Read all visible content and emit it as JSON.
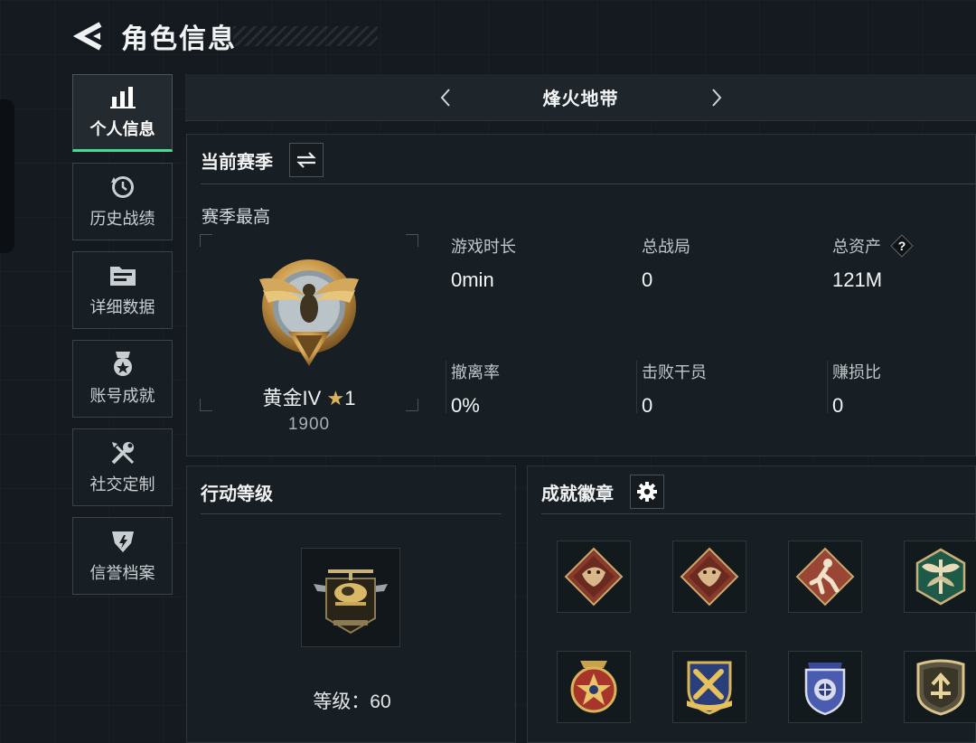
{
  "header": {
    "title": "角色信息"
  },
  "sidebar": {
    "items": [
      {
        "label": "个人信息",
        "icon": "bar-chart-icon",
        "active": true
      },
      {
        "label": "历史战绩",
        "icon": "history-clock-icon",
        "active": false
      },
      {
        "label": "详细数据",
        "icon": "folder-icon",
        "active": false
      },
      {
        "label": "账号成就",
        "icon": "medal-icon",
        "active": false
      },
      {
        "label": "社交定制",
        "icon": "tools-icon",
        "active": false
      },
      {
        "label": "信誉档案",
        "icon": "shield-icon",
        "active": false
      }
    ]
  },
  "mode_bar": {
    "name": "烽火地带"
  },
  "season": {
    "title": "当前赛季",
    "subtitle": "赛季最高",
    "rank": {
      "name": "黄金IV",
      "star": "★",
      "stars": "1",
      "score": "1900",
      "numeral": "IV"
    },
    "stats": [
      {
        "label": "游戏时长",
        "value": "0min"
      },
      {
        "label": "总战局",
        "value": "0"
      },
      {
        "label": "总资产",
        "value": "121M",
        "help": "?"
      },
      {
        "label": "撤离率",
        "value": "0%"
      },
      {
        "label": "击败干员",
        "value": "0"
      },
      {
        "label": "赚损比",
        "value": "0"
      }
    ]
  },
  "level": {
    "title": "行动等级",
    "text": "等级：60"
  },
  "badges": {
    "title": "成就徽章",
    "items": [
      "dragon-badge-icon",
      "dragon-badge-icon",
      "runner-badge-icon",
      "dragonfly-badge-icon",
      "star-medal-badge-icon",
      "wrench-shield-badge-icon",
      "police-badge-icon",
      "arrow-shield-badge-icon"
    ]
  },
  "colors": {
    "accent": "#3ee08f",
    "gold": "#d9b45c",
    "background": "#141a1f"
  }
}
